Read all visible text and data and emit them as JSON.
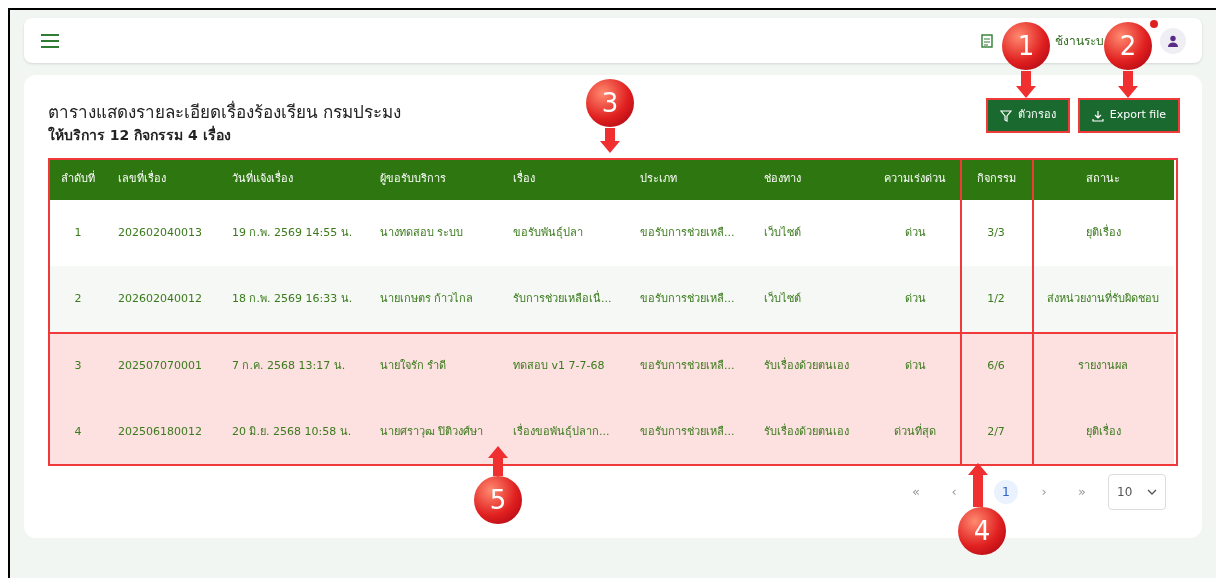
{
  "header": {
    "help_text": "ช้งานระบ"
  },
  "title": "ตารางแสดงรายละเอียดเรื่องร้องเรียน กรมประมง",
  "subtitle": "ให้บริการ 12 กิจกรรม 4 เรื่อง",
  "actions": [
    {
      "kind": "filter",
      "label": "ตัวกรอง"
    },
    {
      "kind": "export",
      "label": "Export file"
    }
  ],
  "table": {
    "columns": [
      "ลำดับที่",
      "เลขที่เรื่อง",
      "วันที่แจ้งเรื่อง",
      "ผู้ขอรับบริการ",
      "เรื่อง",
      "ประเภท",
      "ช่องทาง",
      "ความเร่งด่วน",
      "กิจกรรม",
      "สถานะ"
    ],
    "rows": [
      {
        "highlighted": false,
        "cells": [
          "1",
          "202602040013",
          "19 ก.พ. 2569 14:55 น.",
          "นางทดสอบ ระบบ",
          "ขอรับพันธุ์ปลา",
          "ขอรับการช่วยเหลื...",
          "เว็บไซต์",
          "ด่วน",
          "3/3",
          "ยุติเรื่อง"
        ]
      },
      {
        "highlighted": false,
        "cells": [
          "2",
          "202602040012",
          "18 ก.พ. 2569 16:33 น.",
          "นายเกษตร ก้าวไกล",
          "รับการช่วยเหลือเนื่...",
          "ขอรับการช่วยเหลื...",
          "เว็บไซต์",
          "ด่วน",
          "1/2",
          "ส่งหน่วยงานที่รับผิดชอบ"
        ]
      },
      {
        "highlighted": true,
        "cells": [
          "3",
          "202507070001",
          "7 ก.ค. 2568 13:17 น.",
          "นายใจรัก รำดี",
          "ทดสอบ v1 7-7-68",
          "ขอรับการช่วยเหลื...",
          "รับเรื่องด้วยตนเอง",
          "ด่วน",
          "6/6",
          "รายงานผล"
        ]
      },
      {
        "highlighted": true,
        "cells": [
          "4",
          "202506180012",
          "20 มิ.ย. 2568 10:58 น.",
          "นายศราวุฒ ปิติวงศ์ษา",
          "เรื่องขอพันธุ์ปลาก...",
          "ขอรับการช่วยเหลื...",
          "รับเรื่องด้วยตนเอง",
          "ด่วนที่สุด",
          "2/7",
          "ยุติเรื่อง"
        ]
      }
    ]
  },
  "pagination": {
    "first": "«",
    "prev": "‹",
    "pages": [
      {
        "label": "1",
        "selected": true
      }
    ],
    "next": "›",
    "last": "»",
    "page_size": "10"
  },
  "callouts": [
    {
      "label": "1"
    },
    {
      "label": "2"
    },
    {
      "label": "3"
    },
    {
      "label": "4"
    },
    {
      "label": "5"
    }
  ]
}
